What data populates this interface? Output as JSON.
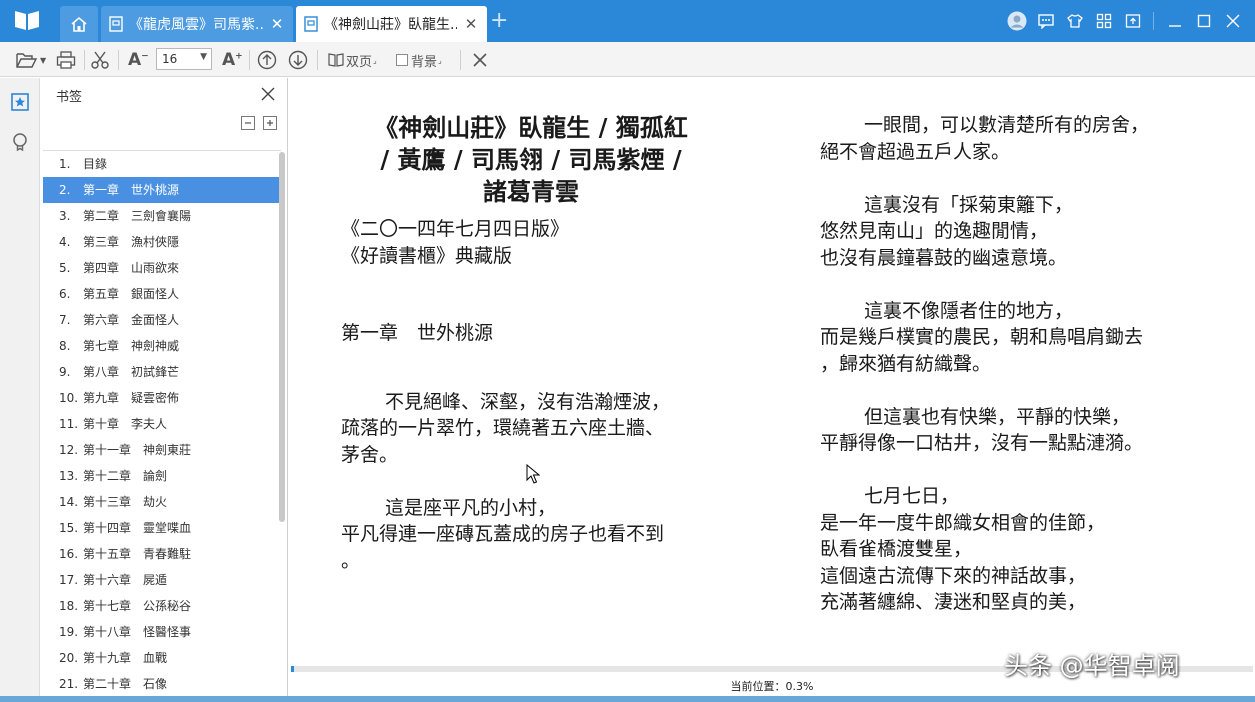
{
  "colors": {
    "titlebar": "#2b87d8",
    "accent": "#4a90e2"
  },
  "tabs": [
    {
      "label": "《龍虎風雲》司馬紫...",
      "active": false
    },
    {
      "label": "《神劍山莊》臥龍生...",
      "active": true
    }
  ],
  "toolbar": {
    "font_size": "16",
    "double_page_label": "双页",
    "background_label": "背景"
  },
  "bookmark_panel": {
    "title": "书签",
    "items": [
      {
        "num": "1.",
        "label": "目錄"
      },
      {
        "num": "2.",
        "label": "第一章　世外桃源"
      },
      {
        "num": "3.",
        "label": "第二章　三劍會襄陽"
      },
      {
        "num": "4.",
        "label": "第三章　漁村俠隱"
      },
      {
        "num": "5.",
        "label": "第四章　山雨欲來"
      },
      {
        "num": "6.",
        "label": "第五章　銀面怪人"
      },
      {
        "num": "7.",
        "label": "第六章　金面怪人"
      },
      {
        "num": "8.",
        "label": "第七章　神劍神威"
      },
      {
        "num": "9.",
        "label": "第八章　初試鋒芒"
      },
      {
        "num": "10.",
        "label": "第九章　疑雲密佈"
      },
      {
        "num": "11.",
        "label": "第十章　李夫人"
      },
      {
        "num": "12.",
        "label": "第十一章　神劍東莊"
      },
      {
        "num": "13.",
        "label": "第十二章　論劍"
      },
      {
        "num": "14.",
        "label": "第十三章　劫火"
      },
      {
        "num": "15.",
        "label": "第十四章　靈堂喋血"
      },
      {
        "num": "16.",
        "label": "第十五章　青春難駐"
      },
      {
        "num": "17.",
        "label": "第十六章　屍遁"
      },
      {
        "num": "18.",
        "label": "第十七章　公孫秘谷"
      },
      {
        "num": "19.",
        "label": "第十八章　怪醫怪事"
      },
      {
        "num": "20.",
        "label": "第十九章　血戰"
      },
      {
        "num": "21.",
        "label": "第二十章　石像"
      }
    ]
  },
  "book": {
    "title_lines": [
      "《神劍山莊》臥龍生 / 獨孤紅",
      "/ 黃鷹 / 司馬翎 / 司馬紫煙 /",
      "諸葛青雲"
    ],
    "edition_lines": [
      "《二〇一四年七月四日版》",
      "《好讀書櫃》典藏版"
    ],
    "chapter_heading": "第一章　世外桃源",
    "left_paragraphs": [
      [
        "不見絕峰、深壑，沒有浩瀚煙波，",
        "疏落的一片翠竹，環繞著五六座土牆、",
        "茅舍。"
      ],
      [
        "這是座平凡的小村，",
        "平凡得連一座磚瓦蓋成的房子也看不到",
        "。"
      ]
    ],
    "right_paragraphs": [
      [
        "一眼間，可以數清楚所有的房舍，",
        "絕不會超過五戶人家。"
      ],
      [
        "這裏沒有「採菊東籬下，",
        "悠然見南山」的逸趣閒情，",
        "也沒有晨鐘暮鼓的幽遠意境。"
      ],
      [
        "這裏不像隱者住的地方，",
        "而是幾戶樸實的農民，朝和鳥唱肩鋤去",
        "，歸來猶有紡織聲。"
      ],
      [
        "但這裏也有快樂，平靜的快樂，",
        "平靜得像一口枯井，沒有一點點漣漪。"
      ],
      [
        "七月七日，",
        "是一年一度牛郎織女相會的佳節，",
        "臥看雀橋渡雙星，",
        "這個遠古流傳下來的神話故事，",
        "充滿著纏綿、淒迷和堅貞的美，"
      ]
    ]
  },
  "status": {
    "position_label": "当前位置：",
    "position_value": "0.3%",
    "progress": 0.003
  },
  "watermark": "头条 @华智卓阅"
}
